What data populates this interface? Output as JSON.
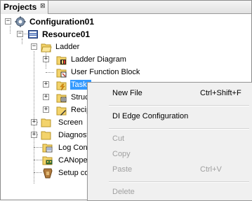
{
  "panel": {
    "tab_label": "Projects",
    "tab_close": "⊠"
  },
  "tree": {
    "configuration": "Configuration01",
    "resource": "Resource01",
    "ladder": "Ladder",
    "ladder_diagram": "Ladder Diagram",
    "user_function_block": "User Function Block",
    "tasks": "Tasks",
    "structure": "Struc",
    "recipe": "Recip",
    "screen": "Screen",
    "diagnostics": "Diagnost",
    "log_config": "Log Conf",
    "canopen": "CANoper",
    "setup": "Setup co"
  },
  "context_menu": {
    "items": [
      {
        "label": "New File",
        "shortcut": "Ctrl+Shift+F",
        "enabled": true
      },
      {
        "label": "DI Edge Configuration",
        "shortcut": "",
        "enabled": true
      },
      {
        "label": "Cut",
        "shortcut": "",
        "enabled": false
      },
      {
        "label": "Copy",
        "shortcut": "",
        "enabled": false
      },
      {
        "label": "Paste",
        "shortcut": "Ctrl+V",
        "enabled": false
      },
      {
        "label": "Delete",
        "shortcut": "",
        "enabled": false
      }
    ]
  },
  "colors": {
    "selection": "#3399ff",
    "menu_bg": "#f0f0f0",
    "disabled_text": "#a0a0a0",
    "folder": "#f3d36b"
  }
}
